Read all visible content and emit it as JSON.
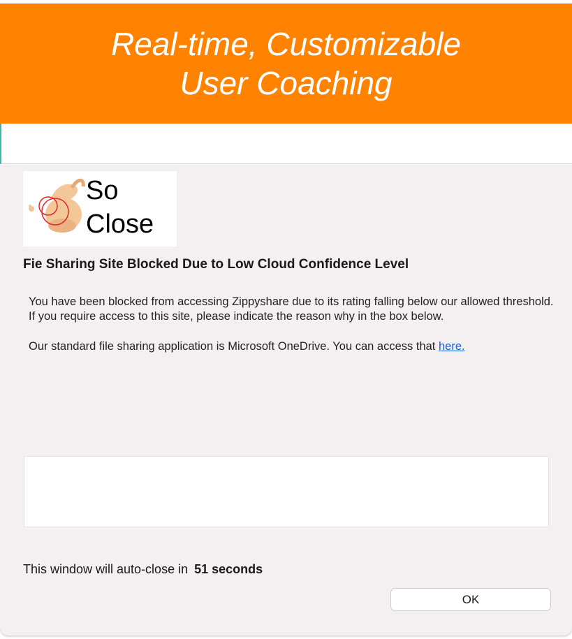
{
  "banner": {
    "line1": "Real-time, Customizable",
    "line2": "User Coaching",
    "color": "#ff8200"
  },
  "dialog": {
    "logo": {
      "icon": "ok-hand-icon",
      "text_line1": "So",
      "text_line2": "Close"
    },
    "heading": "Fie Sharing Site Blocked Due to Low Cloud Confidence Level",
    "paragraph1_line1": "You have been blocked from accessing Zippyshare due to its rating falling below our allowed threshold.",
    "paragraph1_line2": "If you require access to this site, please indicate the reason why in the box below.",
    "paragraph2": "Our standard file sharing application is Microsoft OneDrive. You can access that ",
    "link_text": "here.",
    "reason_input_value": "",
    "countdown_prefix": "This window will auto-close in",
    "countdown_value": "51 seconds",
    "ok_label": "OK",
    "link_color": "#1a5fd0"
  }
}
